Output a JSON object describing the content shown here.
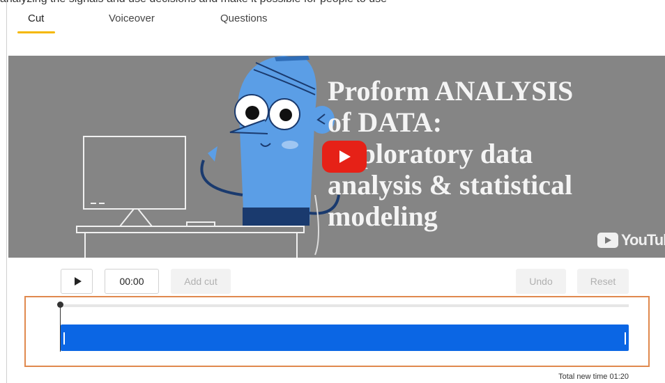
{
  "top_strip_text": "analyzing  the signals and use decisions and  make it possible for people to use",
  "tabs": [
    {
      "label": "Cut"
    },
    {
      "label": "Voiceover"
    },
    {
      "label": "Questions"
    }
  ],
  "video": {
    "title_lines": [
      "Proform ANALYSIS",
      "of DATA:",
      "Exploratory data",
      "analysis & statistical",
      "modeling"
    ],
    "brand": "YouTube",
    "background": "#858585"
  },
  "controls": {
    "time_value": "00:00",
    "add_cut_label": "Add cut",
    "undo_label": "Undo",
    "reset_label": "Reset"
  },
  "timeline": {
    "clip_color": "#0b66e4",
    "highlight_color": "#e0894e",
    "total_time": "Total new time 01:20"
  }
}
